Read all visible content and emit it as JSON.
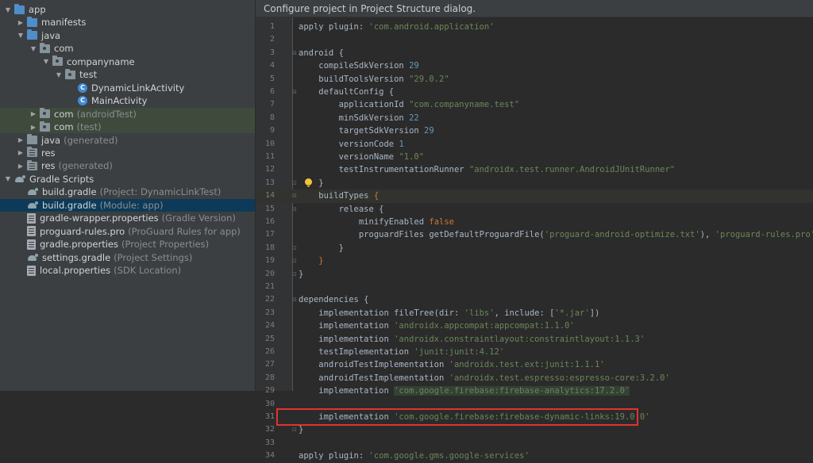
{
  "project_tree": {
    "rows": [
      {
        "indent": 0,
        "arrow": "▼",
        "icon": "folder",
        "name_icon": "folder-icon",
        "label": "app",
        "dim": "",
        "state": ""
      },
      {
        "indent": 1,
        "arrow": "▶",
        "icon": "folder",
        "name_icon": "folder-icon",
        "label": "manifests",
        "dim": "",
        "state": ""
      },
      {
        "indent": 1,
        "arrow": "▼",
        "icon": "folder",
        "name_icon": "folder-icon",
        "label": "java",
        "dim": "",
        "state": ""
      },
      {
        "indent": 2,
        "arrow": "▼",
        "icon": "folder-pkg",
        "name_icon": "package-icon",
        "label": "com",
        "dim": "",
        "state": ""
      },
      {
        "indent": 3,
        "arrow": "▼",
        "icon": "folder-pkg",
        "name_icon": "package-icon",
        "label": "companyname",
        "dim": "",
        "state": ""
      },
      {
        "indent": 4,
        "arrow": "▼",
        "icon": "folder-pkg",
        "name_icon": "package-icon",
        "label": "test",
        "dim": "",
        "state": ""
      },
      {
        "indent": 5,
        "arrow": "",
        "icon": "class",
        "name_icon": "class-icon",
        "label": "DynamicLinkActivity",
        "dim": "",
        "state": ""
      },
      {
        "indent": 5,
        "arrow": "",
        "icon": "class",
        "name_icon": "class-icon",
        "label": "MainActivity",
        "dim": "",
        "state": ""
      },
      {
        "indent": 2,
        "arrow": "▶",
        "icon": "folder-pkg",
        "name_icon": "package-icon",
        "label": "com",
        "dim": "(androidTest)",
        "state": "green"
      },
      {
        "indent": 2,
        "arrow": "▶",
        "icon": "folder-pkg",
        "name_icon": "package-icon",
        "label": "com",
        "dim": "(test)",
        "state": "green"
      },
      {
        "indent": 1,
        "arrow": "▶",
        "icon": "folder",
        "name_icon": "folder-icon",
        "label": "java",
        "dim": "(generated)",
        "state": ""
      },
      {
        "indent": 1,
        "arrow": "▶",
        "icon": "folder-res",
        "name_icon": "resource-folder-icon",
        "label": "res",
        "dim": "",
        "state": ""
      },
      {
        "indent": 1,
        "arrow": "▶",
        "icon": "folder-res",
        "name_icon": "resource-folder-icon",
        "label": "res",
        "dim": "(generated)",
        "state": ""
      },
      {
        "indent": 0,
        "arrow": "▼",
        "icon": "gradle",
        "name_icon": "gradle-icon",
        "label": "Gradle Scripts",
        "dim": "",
        "state": ""
      },
      {
        "indent": 1,
        "arrow": "",
        "icon": "gradle",
        "name_icon": "gradle-icon",
        "label": "build.gradle",
        "dim": "(Project: DynamicLinkTest)",
        "state": ""
      },
      {
        "indent": 1,
        "arrow": "",
        "icon": "gradle",
        "name_icon": "gradle-icon",
        "label": "build.gradle",
        "dim": "(Module: app)",
        "state": "sel"
      },
      {
        "indent": 1,
        "arrow": "",
        "icon": "props",
        "name_icon": "properties-file-icon",
        "label": "gradle-wrapper.properties",
        "dim": "(Gradle Version)",
        "state": ""
      },
      {
        "indent": 1,
        "arrow": "",
        "icon": "props",
        "name_icon": "properties-file-icon",
        "label": "proguard-rules.pro",
        "dim": "(ProGuard Rules for app)",
        "state": ""
      },
      {
        "indent": 1,
        "arrow": "",
        "icon": "props",
        "name_icon": "properties-file-icon",
        "label": "gradle.properties",
        "dim": "(Project Properties)",
        "state": ""
      },
      {
        "indent": 1,
        "arrow": "",
        "icon": "gradle",
        "name_icon": "gradle-icon",
        "label": "settings.gradle",
        "dim": "(Project Settings)",
        "state": ""
      },
      {
        "indent": 1,
        "arrow": "",
        "icon": "props",
        "name_icon": "properties-file-icon",
        "label": "local.properties",
        "dim": "(SDK Location)",
        "state": ""
      }
    ]
  },
  "editor": {
    "banner": "Configure project in Project Structure dialog.",
    "current_line": 14,
    "boxed_line": 31,
    "lines": [
      [
        {
          "t": "apply plugin: "
        },
        {
          "t": "'com.android.application'",
          "c": "str"
        }
      ],
      [],
      [
        {
          "t": "android {"
        }
      ],
      [
        {
          "t": "    compileSdkVersion "
        },
        {
          "t": "29",
          "c": "num"
        }
      ],
      [
        {
          "t": "    buildToolsVersion "
        },
        {
          "t": "\"29.0.2\"",
          "c": "str"
        }
      ],
      [
        {
          "t": "    defaultConfig {"
        }
      ],
      [
        {
          "t": "        applicationId "
        },
        {
          "t": "\"com.companyname.test\"",
          "c": "str"
        }
      ],
      [
        {
          "t": "        minSdkVersion "
        },
        {
          "t": "22",
          "c": "num"
        }
      ],
      [
        {
          "t": "        targetSdkVersion "
        },
        {
          "t": "29",
          "c": "num"
        }
      ],
      [
        {
          "t": "        versionCode "
        },
        {
          "t": "1",
          "c": "num"
        }
      ],
      [
        {
          "t": "        versionName "
        },
        {
          "t": "\"1.0\"",
          "c": "str"
        }
      ],
      [
        {
          "t": "        testInstrumentationRunner "
        },
        {
          "t": "\"androidx.test.runner.AndroidJUnitRunner\"",
          "c": "str"
        }
      ],
      [
        {
          "t": "    }"
        }
      ],
      [
        {
          "t": "    buildTypes "
        },
        {
          "t": "{",
          "c": "brace"
        }
      ],
      [
        {
          "t": "        release {"
        }
      ],
      [
        {
          "t": "            minifyEnabled "
        },
        {
          "t": "false",
          "c": "kw"
        }
      ],
      [
        {
          "t": "            proguardFiles getDefaultProguardFile("
        },
        {
          "t": "'proguard-android-optimize.txt'",
          "c": "str"
        },
        {
          "t": "), "
        },
        {
          "t": "'proguard-rules.pro'",
          "c": "str"
        }
      ],
      [
        {
          "t": "        }"
        }
      ],
      [
        {
          "t": "    "
        },
        {
          "t": "}",
          "c": "brace"
        }
      ],
      [
        {
          "t": "}"
        }
      ],
      [],
      [
        {
          "t": "dependencies {"
        }
      ],
      [
        {
          "t": "    implementation fileTree(dir: "
        },
        {
          "t": "'libs'",
          "c": "str"
        },
        {
          "t": ", include: ["
        },
        {
          "t": "'*.jar'",
          "c": "str"
        },
        {
          "t": "])"
        }
      ],
      [
        {
          "t": "    implementation "
        },
        {
          "t": "'androidx.appcompat:appcompat:1.1.0'",
          "c": "str"
        }
      ],
      [
        {
          "t": "    implementation "
        },
        {
          "t": "'androidx.constraintlayout:constraintlayout:1.1.3'",
          "c": "str"
        }
      ],
      [
        {
          "t": "    testImplementation "
        },
        {
          "t": "'junit:junit:4.12'",
          "c": "str"
        }
      ],
      [
        {
          "t": "    androidTestImplementation "
        },
        {
          "t": "'androidx.test.ext:junit:1.1.1'",
          "c": "str"
        }
      ],
      [
        {
          "t": "    androidTestImplementation "
        },
        {
          "t": "'androidx.test.espresso:espresso-core:3.2.0'",
          "c": "str"
        }
      ],
      [
        {
          "t": "    implementation "
        },
        {
          "t": "'com.google.firebase:firebase-analytics:17.2.0'",
          "c": "str",
          "hl": true
        }
      ],
      [],
      [
        {
          "t": "    implementation "
        },
        {
          "t": "'com.google.firebase:firebase-dynamic-links:19.0.0'",
          "c": "str"
        }
      ],
      [
        {
          "t": "}"
        }
      ],
      [],
      [
        {
          "t": "apply plugin: "
        },
        {
          "t": "'com.google.gms.google-services'",
          "c": "str"
        }
      ]
    ]
  },
  "colors": {
    "selection": "#0d3a58",
    "highlight_box": "#e0332f",
    "string": "#6a8759",
    "number": "#6897bb",
    "keyword": "#cc7832"
  }
}
